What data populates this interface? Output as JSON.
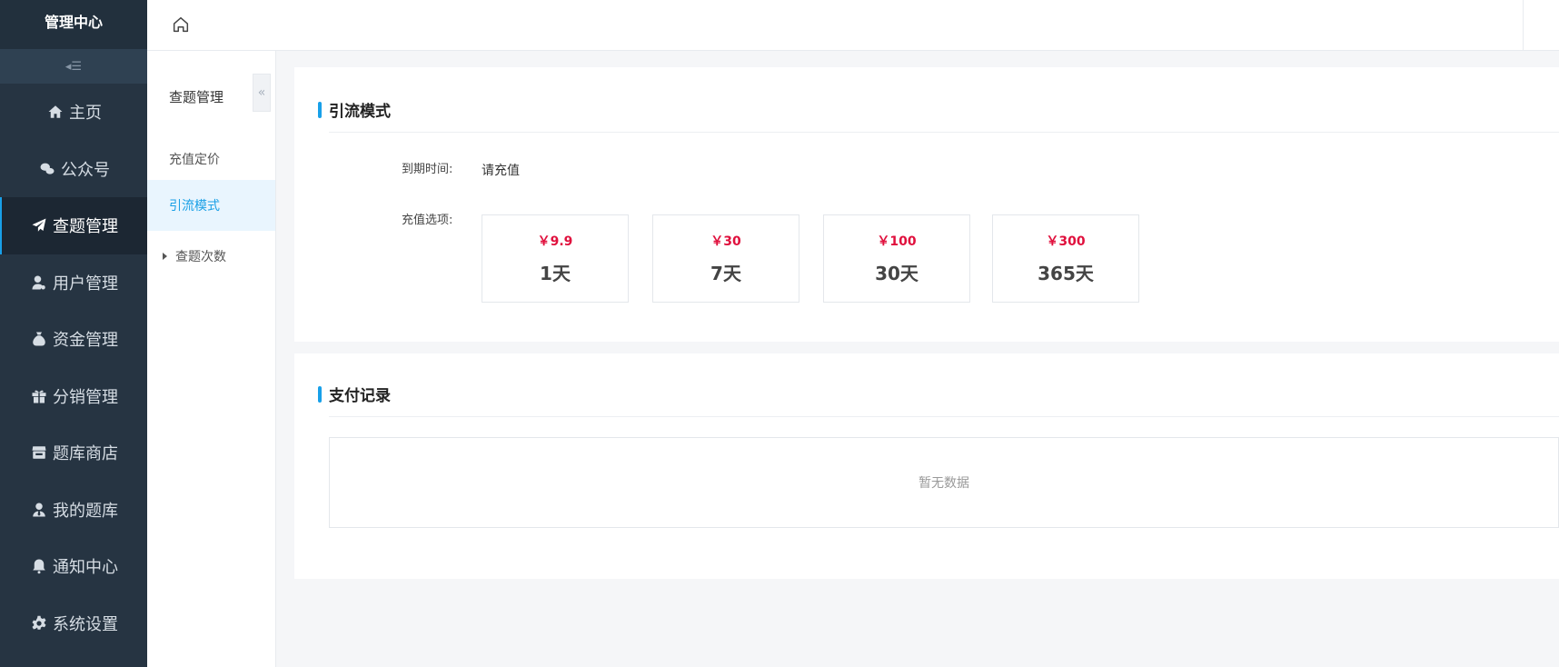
{
  "brand": {
    "title": "管理中心"
  },
  "sidebar": {
    "collapse_icon": "indent-collapse-icon",
    "items": [
      {
        "label": "主页",
        "icon": "home-icon"
      },
      {
        "label": "公众号",
        "icon": "wechat-icon"
      },
      {
        "label": "查题管理",
        "icon": "paper-plane-icon",
        "active": true
      },
      {
        "label": "用户管理",
        "icon": "user-icon"
      },
      {
        "label": "资金管理",
        "icon": "money-bag-icon"
      },
      {
        "label": "分销管理",
        "icon": "gift-icon"
      },
      {
        "label": "题库商店",
        "icon": "store-icon"
      },
      {
        "label": "我的题库",
        "icon": "user-tie-icon"
      },
      {
        "label": "通知中心",
        "icon": "bell-icon"
      },
      {
        "label": "系统设置",
        "icon": "gear-icon"
      }
    ]
  },
  "topbar": {
    "home_icon": "home-outline-icon"
  },
  "subnav": {
    "title": "查题管理",
    "toggle_glyph": "«",
    "items": [
      {
        "label": "充值定价"
      },
      {
        "label": "引流模式",
        "active": true
      },
      {
        "label": "查题次数",
        "has_caret": true
      }
    ]
  },
  "traffic_mode": {
    "title": "引流模式",
    "expire_label": "到期时间:",
    "expire_value": "请充值",
    "options_label": "充值选项:",
    "options": [
      {
        "price": "￥9.9",
        "days": "1天"
      },
      {
        "price": "￥30",
        "days": "7天"
      },
      {
        "price": "￥100",
        "days": "30天"
      },
      {
        "price": "￥300",
        "days": "365天"
      }
    ]
  },
  "payment_records": {
    "title": "支付记录",
    "empty_text": "暂无数据"
  },
  "colors": {
    "sidebar_bg": "#263442",
    "accent": "#18a0e9",
    "price": "#e0103d"
  }
}
